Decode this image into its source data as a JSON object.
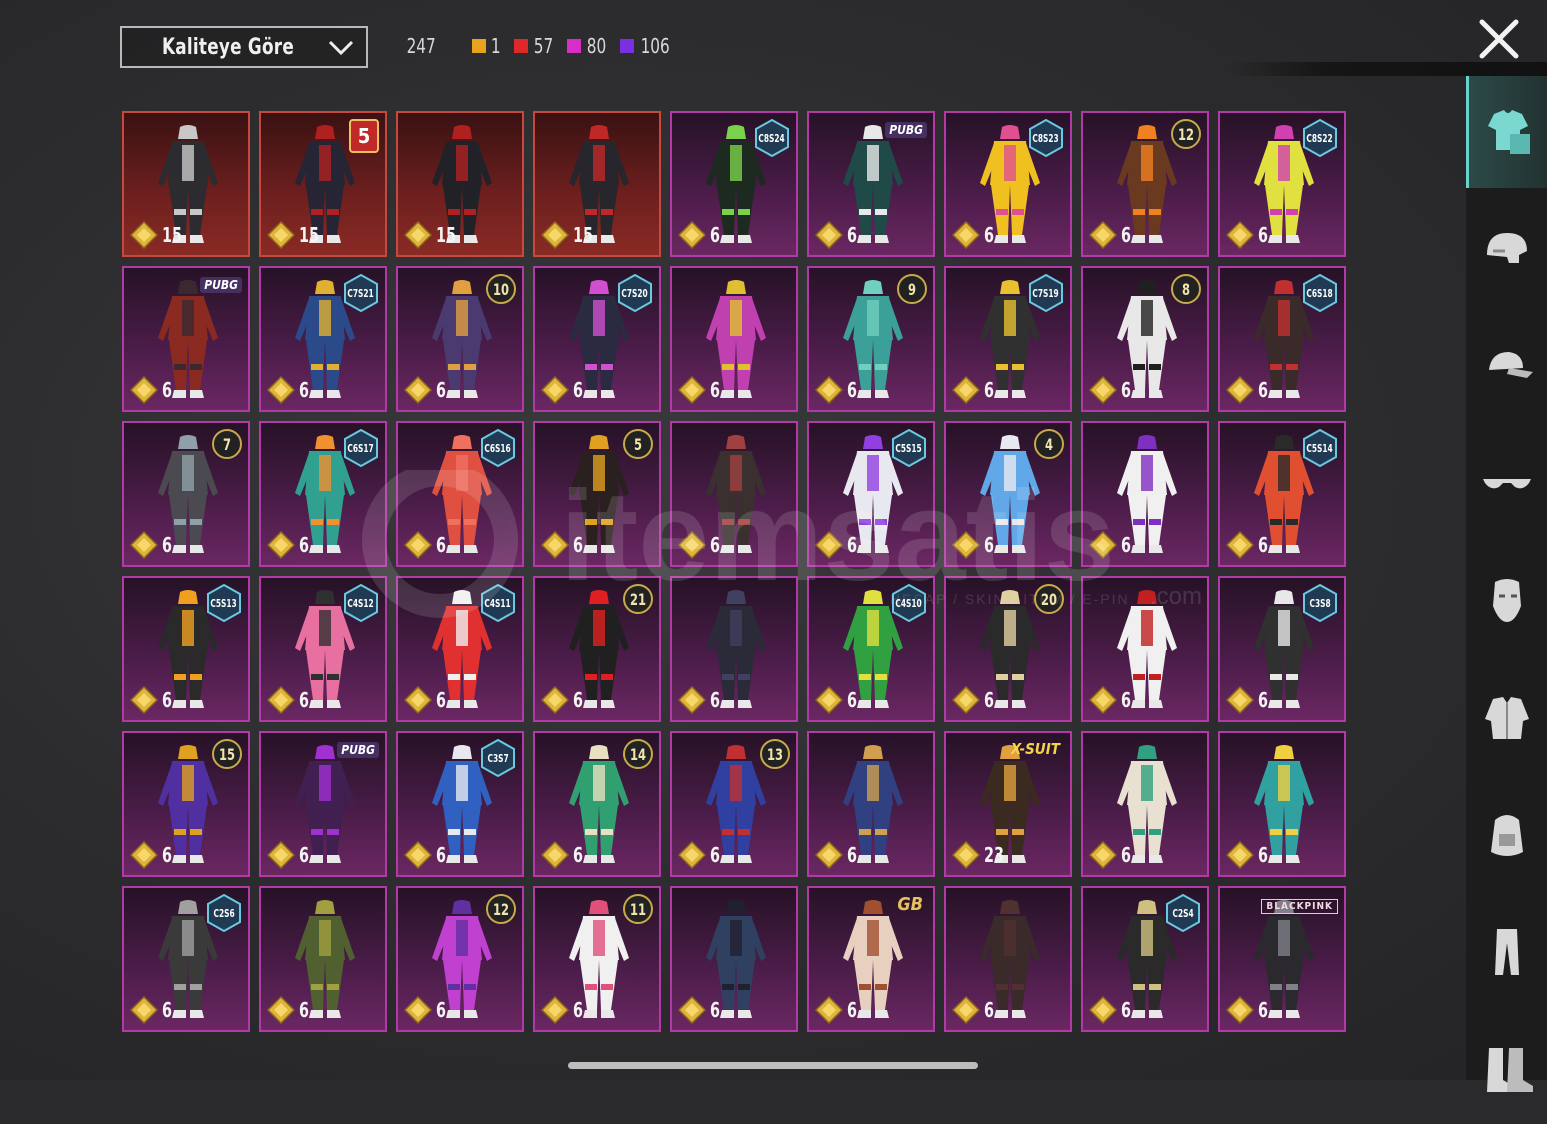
{
  "header": {
    "sort_label": "Kaliteye Göre",
    "total": "247",
    "quality_counts": [
      {
        "color": "#e8a21e",
        "value": "1"
      },
      {
        "color": "#e02828",
        "value": "57"
      },
      {
        "color": "#d62ec6",
        "value": "80"
      },
      {
        "color": "#7a30e0",
        "value": "106"
      }
    ]
  },
  "colors": {
    "red_quality": "#c8473f",
    "pink_quality": "#b338a8",
    "sidebar_active": "#6ad2c8"
  },
  "watermark": {
    "brand": "itemsatis",
    "tagline": "HESAP / SKIN / ITEM / E-PIN",
    "domain": ".com"
  },
  "sidebar": [
    {
      "icon": "outfit-icon",
      "active": true
    },
    {
      "icon": "helmet-icon"
    },
    {
      "icon": "cap-icon"
    },
    {
      "icon": "sunglasses-icon"
    },
    {
      "icon": "mask-icon"
    },
    {
      "icon": "jacket-icon"
    },
    {
      "icon": "backpack-icon"
    },
    {
      "icon": "pants-icon"
    },
    {
      "icon": "boots-icon"
    }
  ],
  "items": [
    {
      "q": "red",
      "price": "15",
      "badge": null,
      "c": "#2b2b30",
      "a": "#c8c8c8"
    },
    {
      "q": "red",
      "price": "15",
      "badge": {
        "type": "red",
        "text": "5"
      },
      "c": "#252535",
      "a": "#b02020"
    },
    {
      "q": "red",
      "price": "15",
      "badge": null,
      "c": "#202228",
      "a": "#b02020"
    },
    {
      "q": "red",
      "price": "15",
      "badge": null,
      "c": "#26262c",
      "a": "#c02828"
    },
    {
      "q": "pink",
      "price": "6",
      "badge": {
        "type": "hex",
        "text": "C8S24"
      },
      "c": "#1c2a20",
      "a": "#7ad24a"
    },
    {
      "q": "pink",
      "price": "6",
      "badge": {
        "type": "text",
        "style": "pop",
        "text": "PUBG"
      },
      "c": "#1f4a48",
      "a": "#e8e8e8"
    },
    {
      "q": "pink",
      "price": "6",
      "badge": {
        "type": "hex",
        "text": "C8S23"
      },
      "c": "#f0c020",
      "a": "#e05090"
    },
    {
      "q": "pink",
      "price": "6",
      "badge": {
        "type": "num",
        "text": "12"
      },
      "c": "#6a3a20",
      "a": "#f08020"
    },
    {
      "q": "pink",
      "price": "6",
      "badge": {
        "type": "hex",
        "text": "C8S22"
      },
      "c": "#e0e040",
      "a": "#d040b0"
    },
    {
      "q": "pink",
      "price": "6",
      "badge": {
        "type": "text",
        "style": "pop",
        "text": "PUBG"
      },
      "c": "#8a2a20",
      "a": "#3a2a30"
    },
    {
      "q": "pink",
      "price": "6",
      "badge": {
        "type": "hex",
        "text": "C7S21"
      },
      "c": "#2a4a8a",
      "a": "#e0b030"
    },
    {
      "q": "pink",
      "price": "6",
      "badge": {
        "type": "num",
        "text": "10"
      },
      "c": "#4a3a70",
      "a": "#e0a040"
    },
    {
      "q": "pink",
      "price": "6",
      "badge": {
        "type": "hex",
        "text": "C7S20"
      },
      "c": "#2a2a40",
      "a": "#d050d0"
    },
    {
      "q": "pink",
      "price": "6",
      "badge": null,
      "c": "#c040b0",
      "a": "#e0c030"
    },
    {
      "q": "pink",
      "price": "6",
      "badge": {
        "type": "num",
        "text": "9"
      },
      "c": "#3aa098",
      "a": "#70d0c0"
    },
    {
      "q": "pink",
      "price": "6",
      "badge": {
        "type": "hex",
        "text": "C7S19"
      },
      "c": "#303030",
      "a": "#e8c030"
    },
    {
      "q": "pink",
      "price": "6",
      "badge": {
        "type": "num",
        "text": "8"
      },
      "c": "#e8e8e8",
      "a": "#202020"
    },
    {
      "q": "pink",
      "price": "6",
      "badge": {
        "type": "hex",
        "text": "C6S18"
      },
      "c": "#3a2a2a",
      "a": "#c03030"
    },
    {
      "q": "pink",
      "price": "6",
      "badge": {
        "type": "num",
        "text": "7"
      },
      "c": "#4a4a50",
      "a": "#90a0a8"
    },
    {
      "q": "pink",
      "price": "6",
      "badge": {
        "type": "hex",
        "text": "C6S17"
      },
      "c": "#30a090",
      "a": "#f09030"
    },
    {
      "q": "pink",
      "price": "6",
      "badge": {
        "type": "hex",
        "text": "C6S16"
      },
      "c": "#e05040",
      "a": "#f07060"
    },
    {
      "q": "pink",
      "price": "6",
      "badge": {
        "type": "num",
        "text": "5"
      },
      "c": "#2a2020",
      "a": "#e0a020"
    },
    {
      "q": "pink",
      "price": "6",
      "badge": null,
      "c": "#3a3030",
      "a": "#a04040"
    },
    {
      "q": "pink",
      "price": "6",
      "badge": {
        "type": "hex",
        "text": "C5S15"
      },
      "c": "#e8e8f0",
      "a": "#9040e0"
    },
    {
      "q": "pink",
      "price": "6",
      "badge": {
        "type": "num",
        "text": "4"
      },
      "c": "#60a8e8",
      "a": "#e8e8f0"
    },
    {
      "q": "pink",
      "price": "6",
      "badge": null,
      "c": "#f0f0f0",
      "a": "#8030c0"
    },
    {
      "q": "pink",
      "price": "6",
      "badge": {
        "type": "hex",
        "text": "C5S14"
      },
      "c": "#e05030",
      "a": "#2a2a2a"
    },
    {
      "q": "pink",
      "price": "6",
      "badge": {
        "type": "hex",
        "text": "C5S13"
      },
      "c": "#2a2a2a",
      "a": "#f0a020"
    },
    {
      "q": "pink",
      "price": "6",
      "badge": {
        "type": "hex",
        "text": "C4S12"
      },
      "c": "#e870a0",
      "a": "#303030"
    },
    {
      "q": "pink",
      "price": "6",
      "badge": {
        "type": "hex",
        "text": "C4S11"
      },
      "c": "#e03030",
      "a": "#f0f0f0"
    },
    {
      "q": "pink",
      "price": "6",
      "badge": {
        "type": "num",
        "text": "21"
      },
      "c": "#202020",
      "a": "#e02020"
    },
    {
      "q": "pink",
      "price": "6",
      "badge": null,
      "c": "#2a2a38",
      "a": "#404060"
    },
    {
      "q": "pink",
      "price": "6",
      "badge": {
        "type": "hex",
        "text": "C4S10"
      },
      "c": "#30a040",
      "a": "#e0e040"
    },
    {
      "q": "pink",
      "price": "6",
      "badge": {
        "type": "num",
        "text": "20"
      },
      "c": "#2a2a2a",
      "a": "#e0d0a0"
    },
    {
      "q": "pink",
      "price": "6",
      "badge": null,
      "c": "#f0f0f0",
      "a": "#c02020"
    },
    {
      "q": "pink",
      "price": "6",
      "badge": {
        "type": "hex",
        "text": "C3S8"
      },
      "c": "#303030",
      "a": "#e8e8e8"
    },
    {
      "q": "pink",
      "price": "6",
      "badge": {
        "type": "num",
        "text": "15"
      },
      "c": "#5030a0",
      "a": "#e0a020"
    },
    {
      "q": "pink",
      "price": "6",
      "badge": {
        "type": "text",
        "style": "pop",
        "text": "PUBG"
      },
      "c": "#402050",
      "a": "#a030d0"
    },
    {
      "q": "pink",
      "price": "6",
      "badge": {
        "type": "hex",
        "text": "C3S7"
      },
      "c": "#3060c0",
      "a": "#e8e8f0"
    },
    {
      "q": "pink",
      "price": "6",
      "badge": {
        "type": "num",
        "text": "14"
      },
      "c": "#30a070",
      "a": "#e8e0c0"
    },
    {
      "q": "pink",
      "price": "6",
      "badge": {
        "type": "num",
        "text": "13"
      },
      "c": "#3040a0",
      "a": "#c03030"
    },
    {
      "q": "pink",
      "price": "6",
      "badge": null,
      "c": "#304080",
      "a": "#d0a050"
    },
    {
      "q": "pink",
      "price": "23",
      "badge": {
        "type": "text",
        "style": "xs",
        "text": "X-SUIT"
      },
      "c": "#3a2a20",
      "a": "#e0a040"
    },
    {
      "q": "pink",
      "price": "6",
      "badge": null,
      "c": "#e8e0d0",
      "a": "#30a080"
    },
    {
      "q": "pink",
      "price": "6",
      "badge": null,
      "c": "#30a0a0",
      "a": "#f0d040"
    },
    {
      "q": "pink",
      "price": "6",
      "badge": {
        "type": "hex",
        "text": "C2S6"
      },
      "c": "#3a3a3a",
      "a": "#a0a0a0"
    },
    {
      "q": "pink",
      "price": "6",
      "badge": null,
      "c": "#506030",
      "a": "#a0a040"
    },
    {
      "q": "pink",
      "price": "6",
      "badge": {
        "type": "num",
        "text": "12"
      },
      "c": "#c040d0",
      "a": "#6030a0"
    },
    {
      "q": "pink",
      "price": "6",
      "badge": {
        "type": "num",
        "text": "11"
      },
      "c": "#f0f0f0",
      "a": "#e0507a"
    },
    {
      "q": "pink",
      "price": "6",
      "badge": null,
      "c": "#304060",
      "a": "#202030"
    },
    {
      "q": "pink",
      "price": "6",
      "badge": {
        "type": "text",
        "style": "gb",
        "text": "GB"
      },
      "c": "#e8d0c0",
      "a": "#a05030"
    },
    {
      "q": "pink",
      "price": "6",
      "badge": null,
      "c": "#3a2a2a",
      "a": "#503030"
    },
    {
      "q": "pink",
      "price": "6",
      "badge": {
        "type": "hex",
        "text": "C2S4"
      },
      "c": "#2a2a2a",
      "a": "#d0c080"
    },
    {
      "q": "pink",
      "price": "6",
      "badge": {
        "type": "text",
        "style": "bp",
        "text": "BLACKPINK"
      },
      "c": "#2a2a2e",
      "a": "#808088"
    }
  ]
}
